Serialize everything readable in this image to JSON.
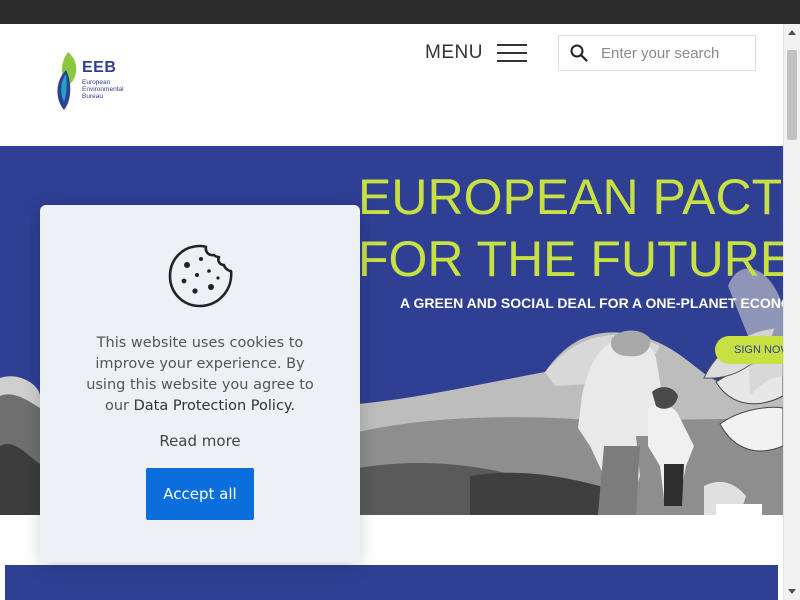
{
  "header": {
    "logo": {
      "abbr": "EEB",
      "line1": "European",
      "line2": "Environmental",
      "line3": "Bureau"
    },
    "menu_label": "MENU",
    "search": {
      "placeholder": "Enter your search"
    }
  },
  "hero": {
    "title_line1": "EUROPEAN PACT",
    "title_line2": "FOR THE FUTURE",
    "subtitle": "A GREEN AND SOCIAL DEAL FOR A ONE-PLANET ECONO",
    "cta_label": "SIGN NOW"
  },
  "cookie_banner": {
    "text": "This website uses cookies to improve your experience. By using this website you agree to our",
    "policy_link": "Data Protection Policy.",
    "read_more": "Read more",
    "accept_label": "Accept all"
  },
  "colors": {
    "brand_blue": "#2f3f93",
    "accent_lime": "#c9e043",
    "button_blue": "#0a6fdd"
  }
}
